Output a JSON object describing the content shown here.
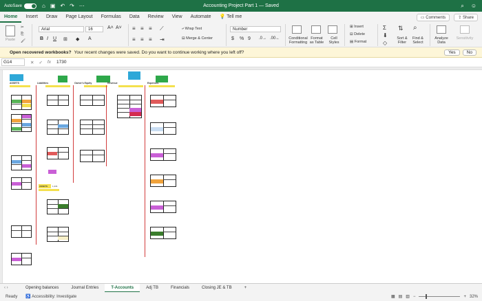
{
  "titlebar": {
    "autosave_label": "AutoSave",
    "autosave_state": "ON",
    "title": "Accounting Project Part 1 — Saved"
  },
  "ribbon_tabs": [
    "Home",
    "Insert",
    "Draw",
    "Page Layout",
    "Formulas",
    "Data",
    "Review",
    "View",
    "Automate",
    "Tell me"
  ],
  "ribbon_tab_icons": {
    "tell_me": "lightbulb-icon"
  },
  "actions": {
    "comments": "Comments",
    "share": "Share"
  },
  "ribbon": {
    "paste": "Paste",
    "font_name": "Arial",
    "font_size": "16",
    "wrap_text": "Wrap Text",
    "merge_center": "Merge & Center",
    "number_format": "Number",
    "conditional_formatting": "Conditional Formatting",
    "format_as_table": "Format as Table",
    "cell_styles": "Cell Styles",
    "insert": "Insert",
    "delete": "Delete",
    "format": "Format",
    "sort_filter": "Sort & Filter",
    "find_select": "Find & Select",
    "analyze_data": "Analyze Data",
    "sensitivity": "Sensitivity"
  },
  "infobar": {
    "title": "Open recovered workbooks?",
    "message": "Your recent changes were saved. Do you want to continue working where you left off?",
    "yes": "Yes",
    "no": "No"
  },
  "formula_bar": {
    "cell_ref": "G14",
    "value": "1730"
  },
  "sheet": {
    "headers": [
      {
        "text": "ASSETS",
        "color": "#2ea8d8"
      },
      {
        "text": "Liabilities",
        "color": "#ffffff"
      },
      {
        "text": "Owner's Equity",
        "color": "#ffffff"
      },
      {
        "text": "Revenue",
        "color": "#2ea84a"
      },
      {
        "text": "Expenses",
        "color": "#2ea84a"
      }
    ],
    "assets_label": "ASSETS",
    "assets_value": "1,441",
    "fill_colors": [
      "#f4e04d",
      "#e05a5a",
      "#c95fd6",
      "#57b356",
      "#f1a33c",
      "#6aa7e0",
      "#3a7d2c",
      "#d42c50"
    ]
  },
  "sheet_tabs": [
    "Opening balances",
    "Journal Entries",
    "T-Accounts",
    "Adj TB",
    "Financials",
    "Closing JE & TB"
  ],
  "active_sheet": "T-Accounts",
  "status": {
    "ready": "Ready",
    "accessibility": "Accessibility: Investigate",
    "zoom": "32%"
  }
}
